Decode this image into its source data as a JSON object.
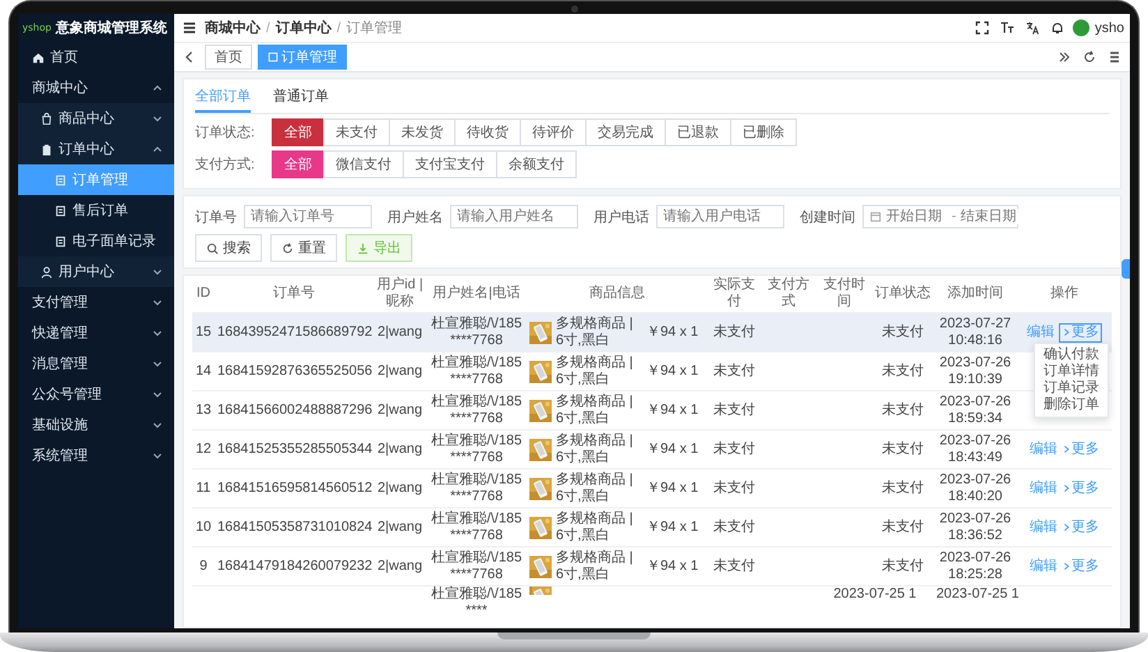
{
  "sidebar": {
    "logo": "yshop",
    "title": "意象商城管理系统",
    "items": [
      {
        "label": "首页",
        "selected": false
      },
      {
        "label": "商城中心",
        "expanded": true,
        "selected": false,
        "children": [
          {
            "label": "商品中心",
            "expanded": false,
            "selected": false
          },
          {
            "label": "订单中心",
            "expanded": true,
            "selected": false,
            "children": [
              {
                "label": "订单管理",
                "selected": true
              },
              {
                "label": "售后订单",
                "selected": false
              },
              {
                "label": "电子面单记录",
                "selected": false
              }
            ]
          },
          {
            "label": "用户中心",
            "expanded": false,
            "selected": false
          }
        ]
      },
      {
        "label": "支付管理",
        "expanded": false,
        "selected": false
      },
      {
        "label": "快递管理",
        "expanded": false,
        "selected": false
      },
      {
        "label": "消息管理",
        "expanded": false,
        "selected": false
      },
      {
        "label": "公众号管理",
        "expanded": false,
        "selected": false
      },
      {
        "label": "基础设施",
        "expanded": false,
        "selected": false
      },
      {
        "label": "系统管理",
        "expanded": false,
        "selected": false
      }
    ]
  },
  "topbar": {
    "breadcrumb": [
      "商城中心",
      "订单中心",
      "订单管理"
    ],
    "separator": "/",
    "user": "ysho"
  },
  "tags": [
    {
      "label": "首页",
      "selected": false
    },
    {
      "label": "订单管理",
      "selected": true
    }
  ],
  "tabs": [
    {
      "label": "全部订单",
      "selected": true
    },
    {
      "label": "普通订单",
      "selected": false
    }
  ],
  "filters": [
    {
      "label": "订单状态:",
      "color": "#c9303e",
      "options": [
        {
          "label": "全部",
          "selected": true
        },
        {
          "label": "未支付",
          "selected": false
        },
        {
          "label": "未发货",
          "selected": false
        },
        {
          "label": "待收货",
          "selected": false
        },
        {
          "label": "待评价",
          "selected": false
        },
        {
          "label": "交易完成",
          "selected": false
        },
        {
          "label": "已退款",
          "selected": false
        },
        {
          "label": "已删除",
          "selected": false
        }
      ]
    },
    {
      "label": "支付方式:",
      "color": "#e8388a",
      "options": [
        {
          "label": "全部",
          "selected": true
        },
        {
          "label": "微信支付",
          "selected": false
        },
        {
          "label": "支付宝支付",
          "selected": false
        },
        {
          "label": "余额支付",
          "selected": false
        }
      ]
    }
  ],
  "search": {
    "fields": [
      {
        "label": "订单号",
        "placeholder": "请输入订单号"
      },
      {
        "label": "用户姓名",
        "placeholder": "请输入用户姓名"
      },
      {
        "label": "用户电话",
        "placeholder": "请输入用户电话"
      }
    ],
    "date": {
      "label": "创建时间",
      "start_placeholder": "开始日期",
      "separator": "-",
      "end_placeholder": "结束日期"
    },
    "buttons": [
      {
        "label": "搜索",
        "kind": "default"
      },
      {
        "label": "重置",
        "kind": "reset"
      },
      {
        "label": "导出",
        "kind": "export"
      }
    ]
  },
  "table": {
    "columns": [
      "ID",
      "订单号",
      "用户id | 昵称",
      "用户姓名|电话",
      "商品信息",
      "实际支付",
      "支付方式",
      "支付时间",
      "订单状态",
      "添加时间",
      "操作"
    ],
    "rows": [
      {
        "id": "15",
        "order_no": "16843952471586689792",
        "user": "2|wang",
        "contact": "杜宣雅聪/\\/185****7768",
        "goods": "多规格商品 | 6寸,黑白",
        "price": "￥94 x 1",
        "paid": "未支付",
        "status": "未支付",
        "added": "2023-07-27 10:48:16",
        "highlighted": true,
        "actions": [
          "编辑",
          "更多"
        ],
        "menu": [
          "确认付款",
          "订单详情",
          "订单记录",
          "删除订单"
        ]
      },
      {
        "id": "14",
        "order_no": "16841592876365525056",
        "user": "2|wang",
        "contact": "杜宣雅聪/\\/185****7768",
        "goods": "多规格商品 | 6寸,黑白",
        "price": "￥94 x 1",
        "paid": "未支付",
        "status": "未支付",
        "added": "2023-07-26 19:10:39",
        "highlighted": false
      },
      {
        "id": "13",
        "order_no": "16841566002488887296",
        "user": "2|wang",
        "contact": "杜宣雅聪/\\/185****7768",
        "goods": "多规格商品 | 6寸,黑白",
        "price": "￥94 x 1",
        "paid": "未支付",
        "status": "未支付",
        "added": "2023-07-26 18:59:34",
        "highlighted": false
      },
      {
        "id": "12",
        "order_no": "16841525355285505344",
        "user": "2|wang",
        "contact": "杜宣雅聪/\\/185****7768",
        "goods": "多规格商品 | 6寸,黑白",
        "price": "￥94 x 1",
        "paid": "未支付",
        "status": "未支付",
        "added": "2023-07-26 18:43:49",
        "highlighted": false,
        "actions": [
          "编辑",
          "更多"
        ]
      },
      {
        "id": "11",
        "order_no": "16841516595814560512",
        "user": "2|wang",
        "contact": "杜宣雅聪/\\/185****7768",
        "goods": "多规格商品 | 6寸,黑白",
        "price": "￥94 x 1",
        "paid": "未支付",
        "status": "未支付",
        "added": "2023-07-26 18:40:20",
        "highlighted": false,
        "actions": [
          "编辑",
          "更多"
        ]
      },
      {
        "id": "10",
        "order_no": "16841505358731010824",
        "user": "2|wang",
        "contact": "杜宣雅聪/\\/185****7768",
        "goods": "多规格商品 | 6寸,黑白",
        "price": "￥94 x 1",
        "paid": "未支付",
        "status": "未支付",
        "added": "2023-07-26 18:36:52",
        "highlighted": false,
        "actions": [
          "编辑",
          "更多"
        ]
      },
      {
        "id": "9",
        "order_no": "16841479184260079232",
        "user": "2|wang",
        "contact": "杜宣雅聪/\\/185****7768",
        "goods": "多规格商品 | 6寸,黑白",
        "price": "￥94 x 1",
        "paid": "未支付",
        "status": "未支付",
        "added": "2023-07-26 18:25:28",
        "highlighted": false,
        "actions": [
          "编辑",
          "更多"
        ]
      }
    ],
    "partial_row": {
      "contact": "杜宣雅聪/\\/185****",
      "pay_time": "2023-07-25 1",
      "added": "2023-07-25 1"
    }
  }
}
